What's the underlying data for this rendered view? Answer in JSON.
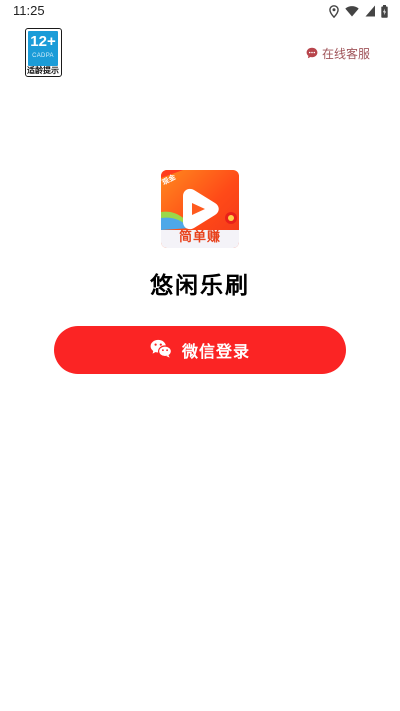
{
  "status_bar": {
    "time": "11:25"
  },
  "age_rating": {
    "number": "12+",
    "code": "CADPA",
    "caption": "适龄提示"
  },
  "header": {
    "service_label": "在线客服"
  },
  "app": {
    "icon_caption": "简单赚",
    "icon_tag": "现金",
    "name": "悠闲乐刷"
  },
  "login": {
    "button_label": "微信登录"
  },
  "colors": {
    "primary": "#fb2424",
    "service_text": "#a0555a",
    "age_badge_blue": "#1b9cd8"
  }
}
